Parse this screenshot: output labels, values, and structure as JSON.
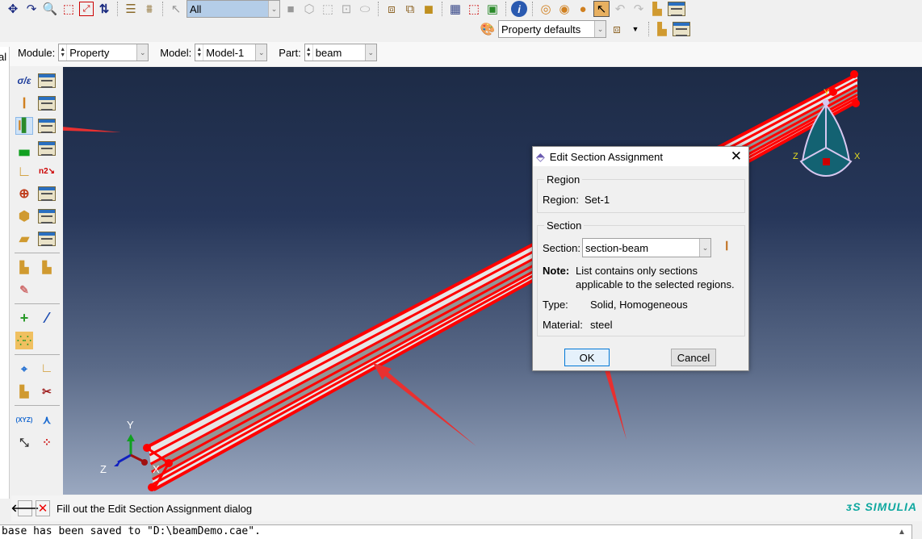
{
  "toolbar": {
    "selection_filter": "All",
    "render_style": "Property defaults"
  },
  "context_bar": {
    "module_label": "Module:",
    "module_value": "Property",
    "model_label": "Model:",
    "model_value": "Model-1",
    "part_label": "Part:",
    "part_value": "beam"
  },
  "tree_panel_fragment": "al",
  "viewport": {
    "triad": {
      "x": "X",
      "y": "Y",
      "z": "Z"
    },
    "view_cube": {
      "x": "X",
      "y": "Y",
      "z": "Z"
    },
    "annotation_color": "#e83030",
    "edge_color": "#ff0000"
  },
  "dialog": {
    "title": "Edit Section Assignment",
    "region_group": "Region",
    "region_label": "Region:",
    "region_value": "Set-1",
    "section_group": "Section",
    "section_label": "Section:",
    "section_value": "section-beam",
    "note_label": "Note:",
    "note_line1": "List contains only sections",
    "note_line2": "applicable to the selected regions.",
    "type_label": "Type:",
    "type_value": "Solid, Homogeneous",
    "material_label": "Material:",
    "material_value": "steel",
    "ok": "OK",
    "cancel": "Cancel"
  },
  "prompt": {
    "text": "Fill out the Edit Section Assignment dialog"
  },
  "brand": "SIMULIA",
  "message": "base has been saved to \"D:\\beamDemo.cae\"."
}
